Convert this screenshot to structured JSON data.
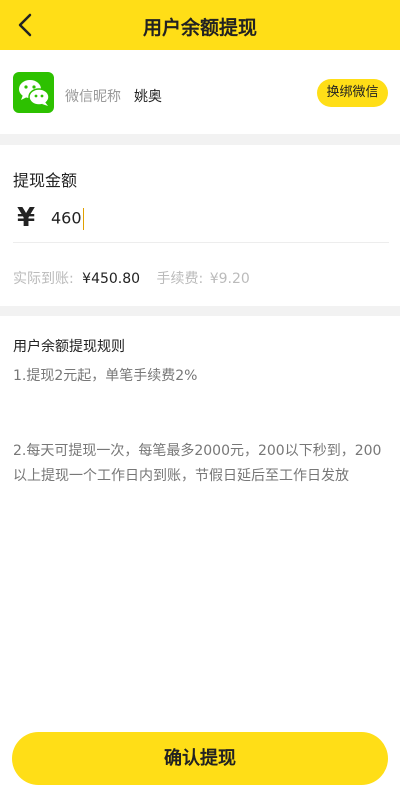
{
  "header": {
    "title": "用户余额提现",
    "back_icon": "chevron-left-icon"
  },
  "wechat": {
    "logo_icon": "wechat-icon",
    "nickname_label": "微信昵称",
    "nickname_value": "姚奥",
    "rebind_label": "换绑微信"
  },
  "withdraw": {
    "amount_label": "提现金额",
    "currency_symbol": "¥",
    "amount_value": "460",
    "actual_label": "实际到账:",
    "actual_value": "¥450.80",
    "fee_label": "手续费:",
    "fee_value": "¥9.20"
  },
  "rules": {
    "title": "用户余额提现规则",
    "items": [
      "1.提现2元起，单笔手续费2%",
      "2.每天可提现一次，每笔最多2000元，200以下秒到，200以上提现一个工作日内到账，节假日延后至工作日发放"
    ]
  },
  "actions": {
    "confirm_label": "确认提现"
  },
  "colors": {
    "accent": "#FFDE17",
    "wechat_green": "#2DC100",
    "divider": "#F2F2F2"
  }
}
